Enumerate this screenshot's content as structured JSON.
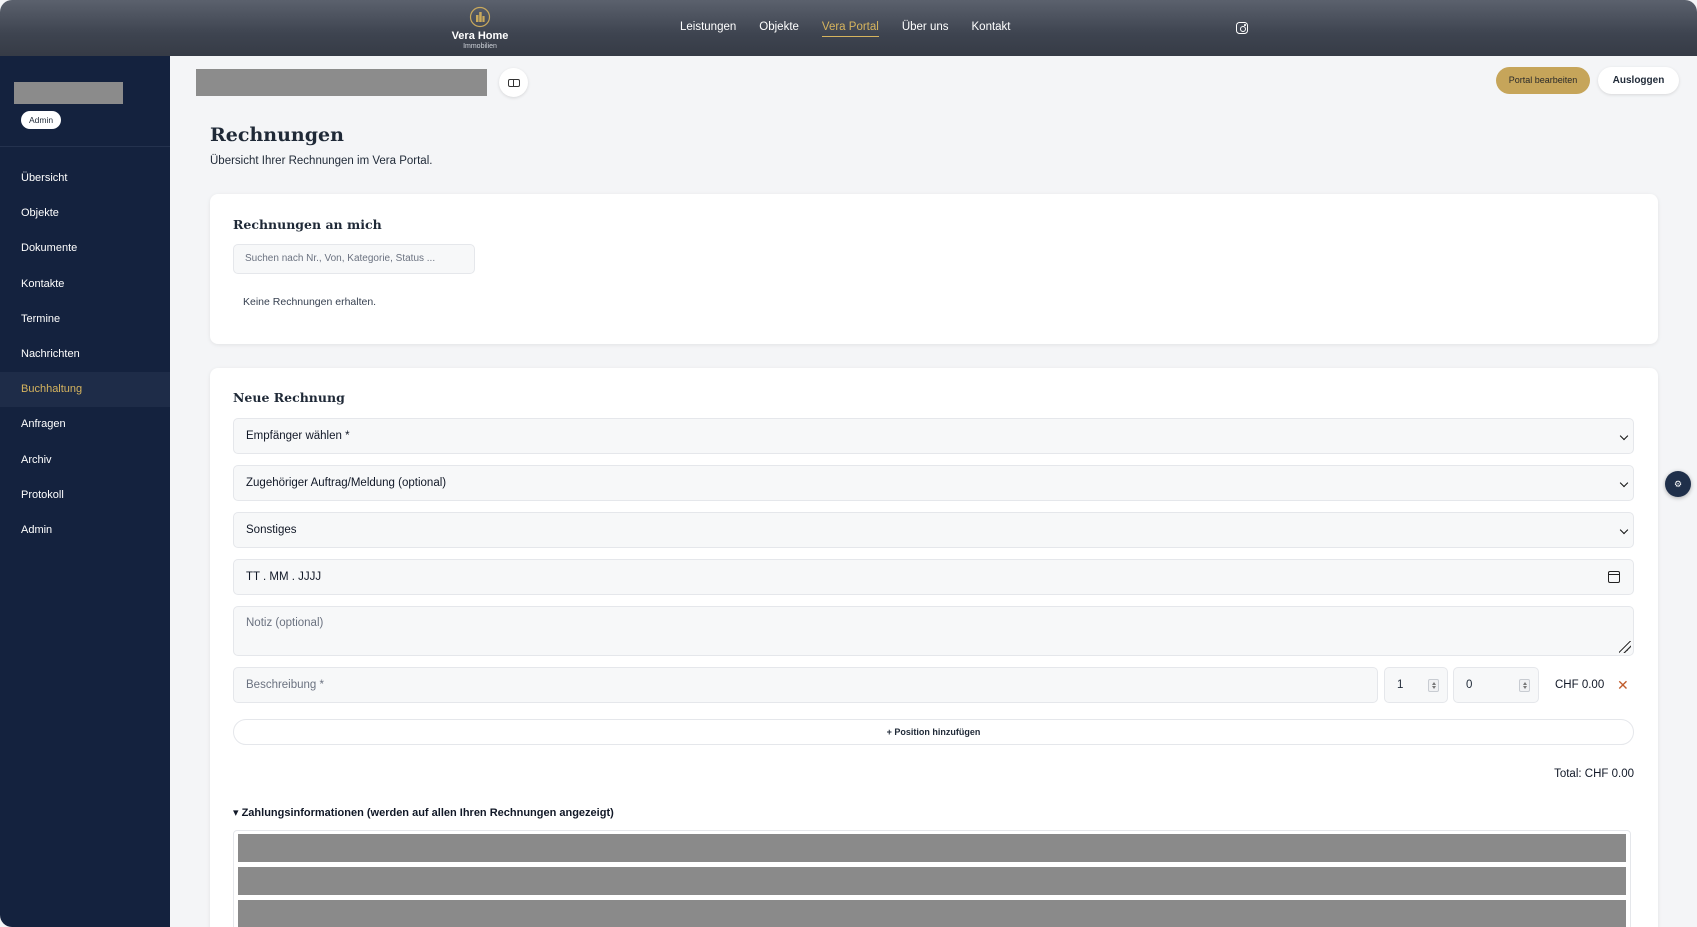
{
  "header": {
    "brand_name": "Vera Home",
    "brand_sub": "Immobilien",
    "nav": [
      {
        "label": "Leistungen"
      },
      {
        "label": "Objekte"
      },
      {
        "label": "Vera Portal",
        "active": true
      },
      {
        "label": "Über uns"
      },
      {
        "label": "Kontakt"
      }
    ],
    "social_icon": "instagram-icon"
  },
  "sidebar": {
    "role_badge": "Admin",
    "items": [
      {
        "label": "Übersicht"
      },
      {
        "label": "Objekte"
      },
      {
        "label": "Dokumente"
      },
      {
        "label": "Kontakte"
      },
      {
        "label": "Termine"
      },
      {
        "label": "Nachrichten"
      },
      {
        "label": "Buchhaltung",
        "active": true
      },
      {
        "label": "Anfragen"
      },
      {
        "label": "Archiv"
      },
      {
        "label": "Protokoll"
      },
      {
        "label": "Admin"
      }
    ]
  },
  "toolbar": {
    "portal_edit": "Portal bearbeiten",
    "logout": "Ausloggen"
  },
  "page": {
    "title": "Rechnungen",
    "subtitle": "Übersicht Ihrer Rechnungen im Vera Portal."
  },
  "received": {
    "title": "Rechnungen an mich",
    "search_placeholder": "Suchen nach Nr., Von, Kategorie, Status ...",
    "empty": "Keine Rechnungen erhalten."
  },
  "new_invoice": {
    "title": "Neue Rechnung",
    "recipient": "Empfänger wählen *",
    "order": "Zugehöriger Auftrag/Meldung (optional)",
    "category": "Sonstiges",
    "date_placeholder": "TT . MM . JJJJ",
    "note_placeholder": "Notiz (optional)",
    "position": {
      "description_placeholder": "Beschreibung *",
      "quantity": "1",
      "price": "0",
      "line_total": "CHF 0.00",
      "remove": "✕"
    },
    "add_position": "+ Position hinzufügen",
    "total": "Total: CHF 0.00",
    "payment_info": "▾ Zahlungsinformationen (werden auf allen Ihren Rechnungen angezeigt)"
  },
  "colors": {
    "accent": "#c6a55a",
    "sidebar": "#14223e"
  }
}
